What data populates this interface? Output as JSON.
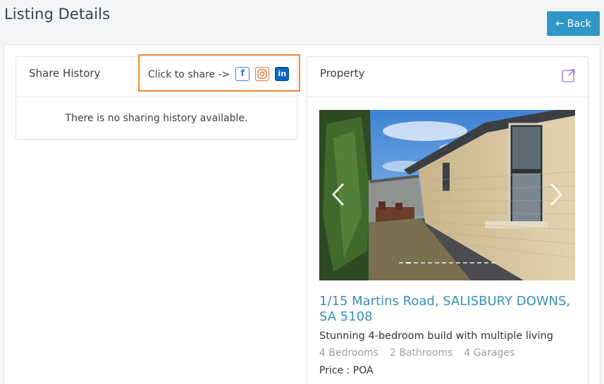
{
  "page": {
    "title": "Listing Details"
  },
  "header": {
    "back_label": "Back",
    "back_icon": "arrow-left-icon"
  },
  "share_history": {
    "title": "Share History",
    "share_prompt": "Click to share ->",
    "networks": [
      {
        "name": "facebook",
        "icon": "facebook-icon",
        "glyph": "f"
      },
      {
        "name": "instagram",
        "icon": "instagram-icon"
      },
      {
        "name": "linkedin",
        "icon": "linkedin-icon",
        "glyph": "in"
      }
    ],
    "empty_message": "There is no sharing history available.",
    "highlight_color": "#ee8a33"
  },
  "property": {
    "title": "Property",
    "open_icon": "external-link-icon",
    "carousel": {
      "slide_count": 14,
      "active_index": 1
    },
    "address": "1/15 Martins Road, SALISBURY DOWNS, SA 5108",
    "headline": "Stunning 4-bedroom build with multiple living",
    "features": [
      "4 Bedrooms",
      "2 Bathrooms",
      "4 Garages"
    ],
    "price_label": "Price : POA"
  },
  "colors": {
    "accent": "#3196c8",
    "link": "#3a8fbd"
  }
}
